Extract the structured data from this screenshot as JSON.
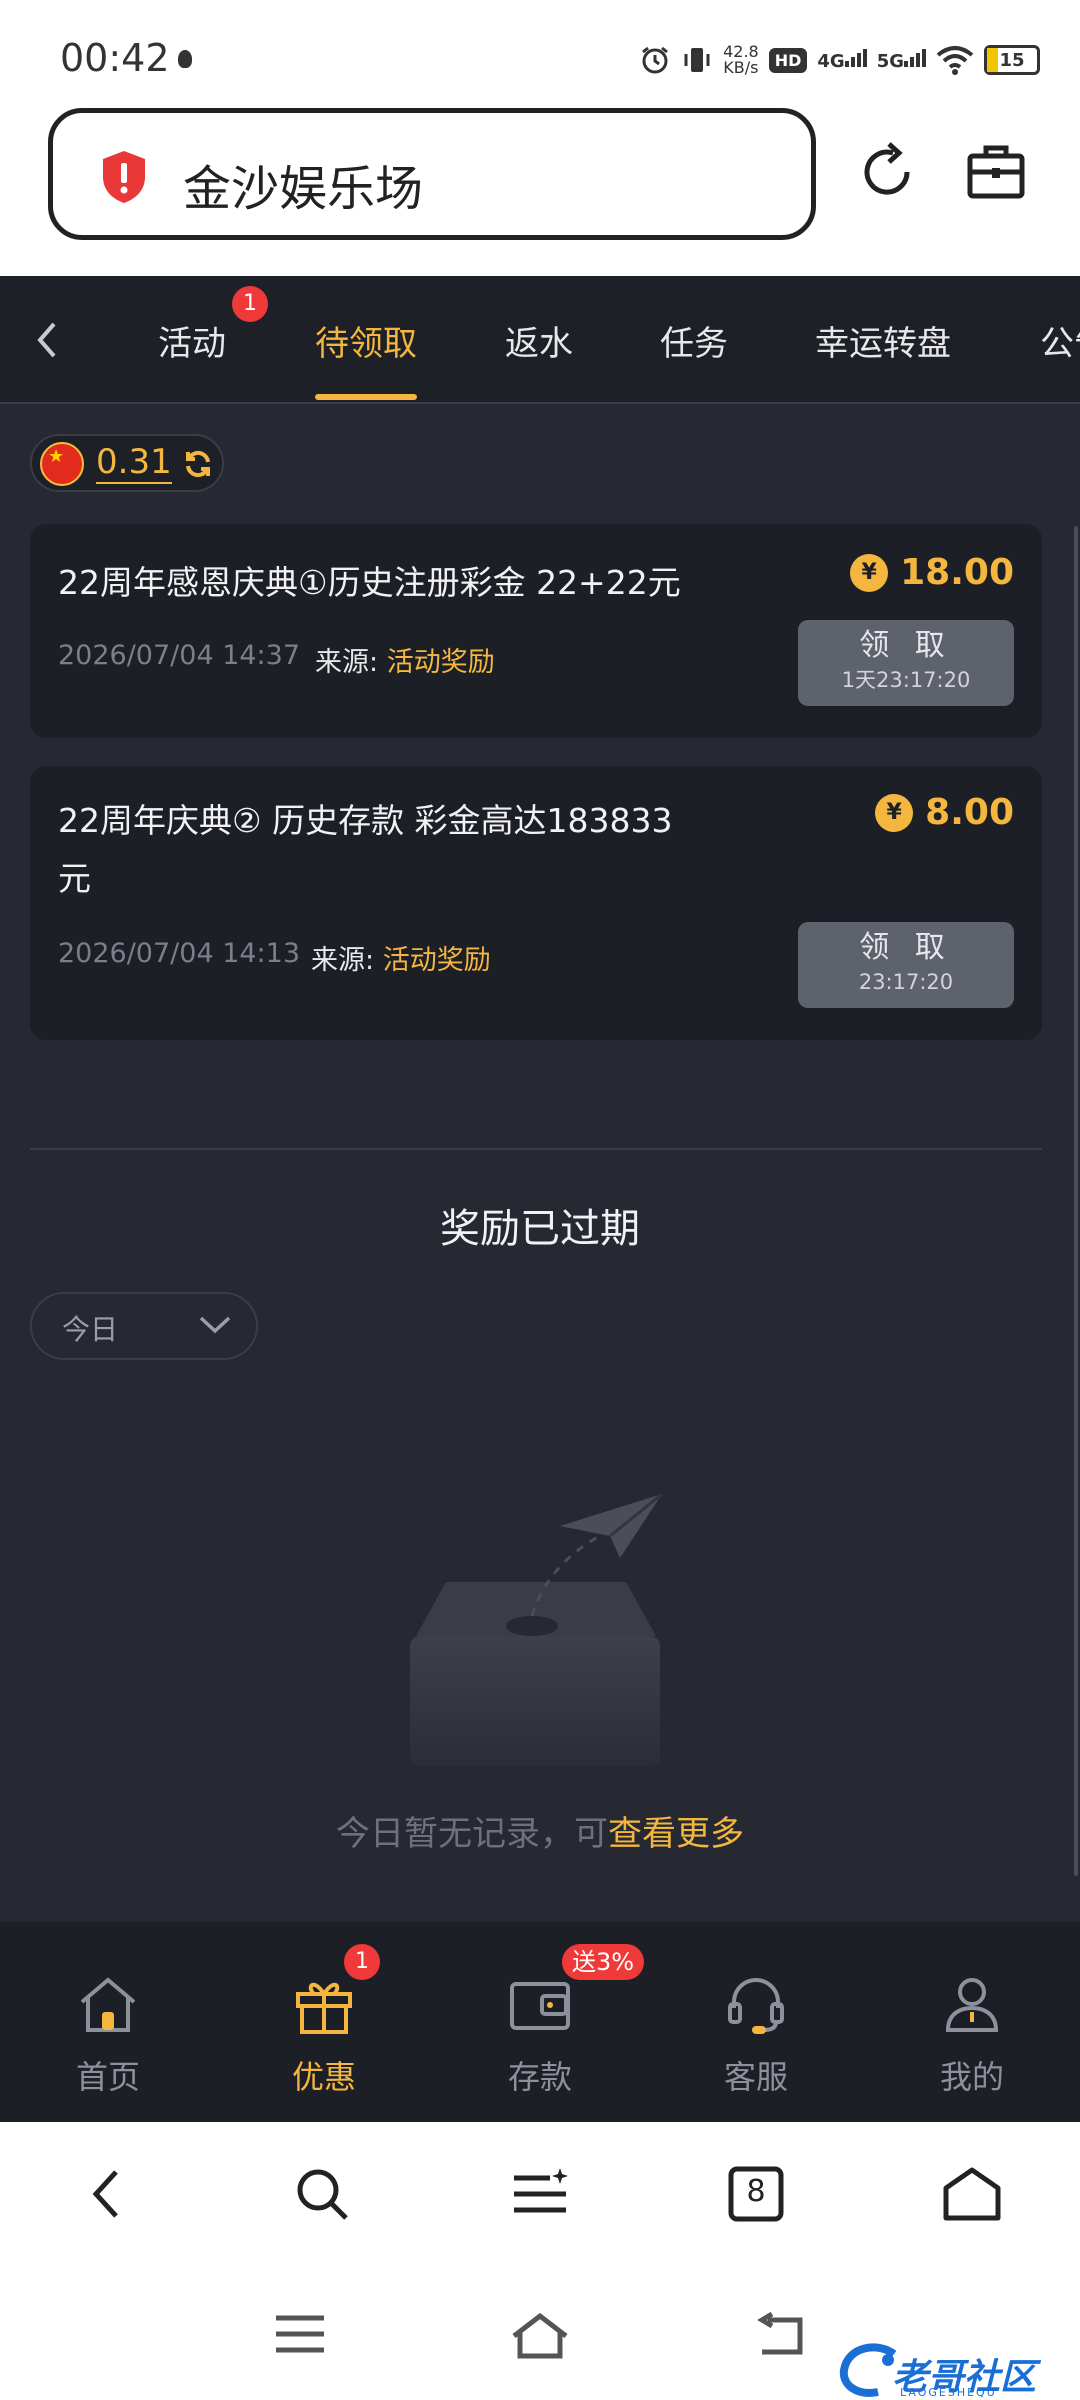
{
  "status_bar": {
    "time": "00:42",
    "net_speed_value": "42.8",
    "net_speed_unit": "KB/s",
    "hd_label": "HD",
    "net_4g": "4G",
    "net_5g": "5G",
    "battery": "15"
  },
  "browser": {
    "url_title": "金沙娱乐场"
  },
  "nav": {
    "tabs": [
      {
        "label": "活动",
        "badge": "1"
      },
      {
        "label": "待领取"
      },
      {
        "label": "返水"
      },
      {
        "label": "任务"
      },
      {
        "label": "幸运转盘"
      },
      {
        "label": "公告"
      }
    ],
    "active_tab": "待领取"
  },
  "balance": {
    "value": "0.31"
  },
  "rewards": [
    {
      "title": "22周年感恩庆典①历史注册彩金 22+22元",
      "amount": "18.00",
      "date": "2026/07/04 14:37",
      "source_label": "来源:",
      "source": "活动奖励",
      "claim_label": "领 取",
      "countdown": "1天23:17:20"
    },
    {
      "title_line1": "22周年庆典② 历史存款 彩金高达183833",
      "title_line2": "元",
      "amount": "8.00",
      "date": "2026/07/04 14:13",
      "source_label": "来源:",
      "source": "活动奖励",
      "claim_label": "领 取",
      "countdown": "23:17:20"
    }
  ],
  "expired": {
    "title": "奖励已过期",
    "date_filter": "今日",
    "empty_text": "今日暂无记录，可",
    "empty_link": "查看更多"
  },
  "bottom_nav": [
    {
      "label": "首页"
    },
    {
      "label": "优惠",
      "badge": "1"
    },
    {
      "label": "存款",
      "badge": "送3%"
    },
    {
      "label": "客服"
    },
    {
      "label": "我的"
    }
  ],
  "browser_toolbar": {
    "tab_count": "8"
  },
  "watermark": {
    "text": "老哥社区",
    "sub": "LAOGESHEQU"
  },
  "colors": {
    "accent": "#f4b63e",
    "background": "#262932",
    "card": "#1d1f26",
    "badge": "#f03a3a"
  }
}
